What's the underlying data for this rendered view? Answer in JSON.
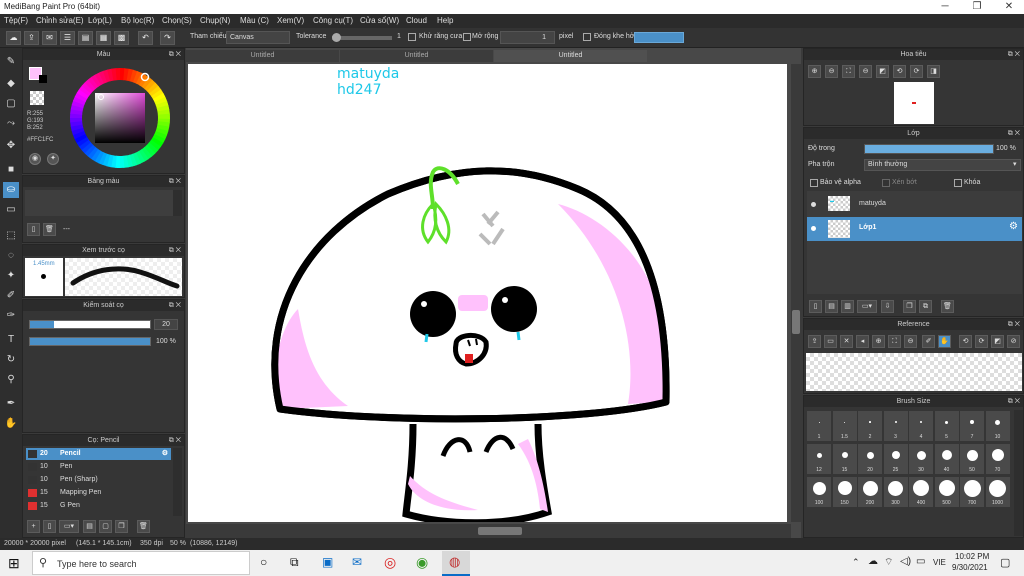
{
  "titlebar": {
    "title": "MediBang Paint Pro (64bit)",
    "minimize": "─",
    "maximize": "❐",
    "close": "✕"
  },
  "menu": [
    "Tệp(F)",
    "Chỉnh sửa(E)",
    "Lớp(L)",
    "Bộ lọc(R)",
    "Chọn(S)",
    "Chụp(N)",
    "Màu (C)",
    "Xem(V)",
    "Công cụ(T)",
    "Cửa sổ(W)",
    "Cloud",
    "Help"
  ],
  "toolbar": {
    "reference_label": "Tham chiếu",
    "reference_value": "Canvas",
    "tolerance_label": "Tolerance",
    "tolerance_value": "1",
    "tolerance_level": 0.0,
    "antialias_label": "Khử răng cưa",
    "expand_label": "Mở rộng",
    "expand_value": "1",
    "pixel_label": "pixel",
    "close_gap_label": "Đóng khe hở"
  },
  "color_panel": {
    "title": "Màu",
    "r": "R:255",
    "g": "G:193",
    "b": "B:252",
    "hex": "#FFC1FC",
    "primary_color": "#ffc1fc"
  },
  "palette_panel": {
    "title": "Bảng màu",
    "dash": "---"
  },
  "brush_preview": {
    "title": "Xem trước cọ",
    "size": "1.45mm"
  },
  "brush_control": {
    "title": "Kiểm soát cọ",
    "size_value": "20",
    "opacity_value": "100 %",
    "size_level": 0.2,
    "opacity_level": 1.0
  },
  "pen_panel": {
    "title": "Cọ: Pencil",
    "items": [
      {
        "size": "20",
        "name": "Pencil",
        "color": "#333333",
        "selected": true
      },
      {
        "size": "10",
        "name": "Pen",
        "color": "#333333"
      },
      {
        "size": "10",
        "name": "Pen (Sharp)",
        "color": "#333333"
      },
      {
        "size": "15",
        "name": "Mapping Pen",
        "color": "#e03030"
      },
      {
        "size": "15",
        "name": "G Pen",
        "color": "#e03030"
      }
    ]
  },
  "canvas": {
    "tabs": [
      "Untitled",
      "Untitled",
      "Untitled"
    ],
    "text_line1": "matuyda",
    "text_line2": "hd247"
  },
  "navigator": {
    "title": "Hoa tiêu"
  },
  "layer_panel": {
    "title": "Lớp",
    "opacity_label": "Độ trong",
    "opacity_value": "100 %",
    "opacity_level": 1.0,
    "blend_label": "Pha trộn",
    "blend_value": "Bình thường",
    "protect_alpha": "Bảo vệ alpha",
    "clipping": "Xén bớt",
    "lock": "Khóa",
    "layers": [
      {
        "name": "matuyda",
        "selected": false
      },
      {
        "name": "Lớp1",
        "selected": true
      }
    ]
  },
  "reference_panel": {
    "title": "Reference"
  },
  "brush_size_panel": {
    "title": "Brush Size",
    "sizes": [
      "1",
      "1.5",
      "2",
      "3",
      "4",
      "5",
      "7",
      "10",
      "12",
      "15",
      "20",
      "25",
      "30",
      "40",
      "50",
      "70",
      "100",
      "150",
      "200",
      "300",
      "400",
      "500",
      "700",
      "1000"
    ]
  },
  "status": {
    "canvas_size": "20000 * 20000 pixel",
    "mm_size": "(145.1 * 145.1cm)",
    "dpi": "350 dpi",
    "zoom": "50 %",
    "cursor": "(10886, 12149)"
  },
  "taskbar": {
    "search_placeholder": "Type here to search",
    "language": "VIE",
    "time": "10:02 PM",
    "date": "9/30/2021"
  }
}
